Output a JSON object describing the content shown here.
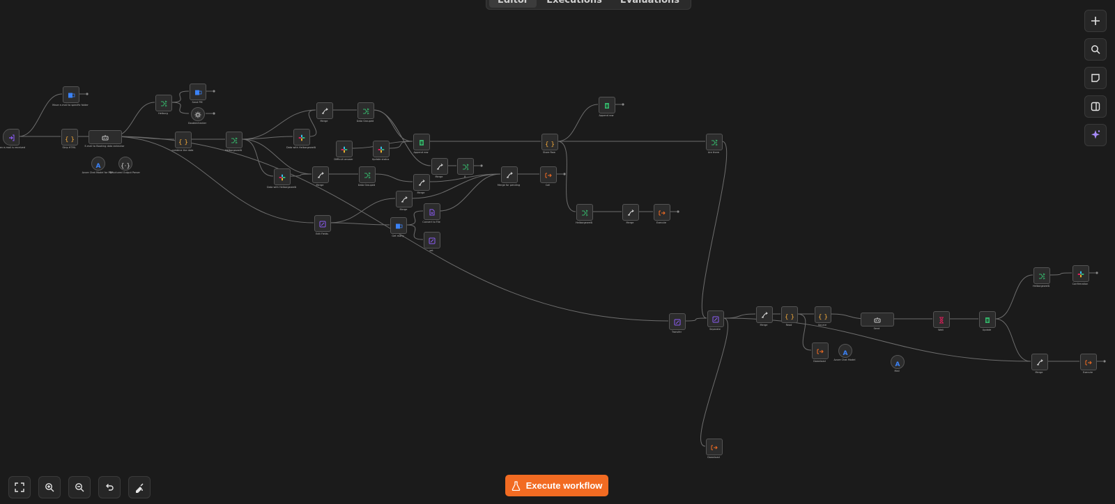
{
  "tabs": [
    {
      "label": "Editor",
      "active": true
    },
    {
      "label": "Executions",
      "active": false
    },
    {
      "label": "Evaluations",
      "active": false
    }
  ],
  "right_tools": [
    {
      "name": "add-node-icon",
      "glyph": "+"
    },
    {
      "name": "search-icon",
      "glyph": "⌕"
    },
    {
      "name": "sticky-note-icon",
      "glyph": "▢"
    },
    {
      "name": "panel-toggle-icon",
      "glyph": "◫"
    },
    {
      "name": "ai-sparkle-icon",
      "glyph": "✦"
    }
  ],
  "bottom_tools": [
    {
      "name": "fit-view-icon",
      "glyph": "⛶"
    },
    {
      "name": "zoom-in-icon",
      "glyph": "⊕"
    },
    {
      "name": "zoom-out-icon",
      "glyph": "⊖"
    },
    {
      "name": "undo-icon",
      "glyph": "↶"
    },
    {
      "name": "tidy-up-icon",
      "glyph": "✎"
    }
  ],
  "execute_button": {
    "label": "Execute workflow",
    "icon": "flask-icon"
  },
  "colors": {
    "background": "#1b1b1b",
    "accent": "#f26b22",
    "node_border": "#555555",
    "edge": "#6e6e6e",
    "green": "#35b46a",
    "blue": "#3b82f6",
    "purple": "#8b5cf6",
    "orange": "#f26b22"
  },
  "nodes": [
    {
      "id": "n1",
      "title": "When e-mail is received",
      "sub": "",
      "icon": "trigger",
      "color": "#8b5cf6"
    },
    {
      "id": "n2",
      "title": "Move e-mail to specific folder",
      "sub": "",
      "icon": "mail",
      "color": "#3b82f6"
    },
    {
      "id": "n3",
      "title": "Strip HTML",
      "sub": "",
      "icon": "code",
      "color": "#f2a93b"
    },
    {
      "id": "n4",
      "title": "E-mail to Booking data extractor",
      "sub": "",
      "icon": "agent",
      "color": "#cccccc"
    },
    {
      "id": "n5",
      "title": "Azure Chat Model for PDF",
      "sub": "",
      "icon": "model",
      "color": "#3b82f6"
    },
    {
      "id": "n6",
      "title": "Structured Output Parser",
      "sub": "",
      "icon": "parser",
      "color": "#cccccc"
    },
    {
      "id": "n7",
      "title": "Helburg",
      "sub": "",
      "icon": "switch",
      "color": "#35b46a"
    },
    {
      "id": "n8",
      "title": "Send PM",
      "sub": "",
      "icon": "mail",
      "color": "#3b82f6"
    },
    {
      "id": "n9",
      "title": "Doublechecker",
      "sub": "",
      "icon": "gear",
      "color": "#cccccc"
    },
    {
      "id": "n10",
      "title": "combine the data",
      "sub": "",
      "icon": "code",
      "color": "#f2a93b"
    },
    {
      "id": "n11",
      "title": "Helbargeweiß",
      "sub": "",
      "icon": "switch",
      "color": "#35b46a"
    },
    {
      "id": "n12",
      "title": "Data with Helbargeweiß",
      "sub": "",
      "icon": "slack",
      "color": "#e01e5a"
    },
    {
      "id": "n13",
      "title": "Data with Helbargeweiß",
      "sub": "",
      "icon": "slack",
      "color": "#e01e5a"
    },
    {
      "id": "n14",
      "title": "Merge",
      "sub": "",
      "icon": "merge",
      "color": "#35b46a"
    },
    {
      "id": "n15",
      "title": "Merge",
      "sub": "",
      "icon": "merge",
      "color": "#35b46a"
    },
    {
      "id": "n16",
      "title": "Data Grouped",
      "sub": "",
      "icon": "switch",
      "color": "#35b46a"
    },
    {
      "id": "n17",
      "title": "Data Grouped",
      "sub": "",
      "icon": "switch",
      "color": "#35b46a"
    },
    {
      "id": "n18",
      "title": "Difficult answer",
      "sub": "",
      "icon": "slack",
      "color": "#e01e5a"
    },
    {
      "id": "n19",
      "title": "Update status",
      "sub": "",
      "icon": "slack",
      "color": "#e01e5a"
    },
    {
      "id": "n20",
      "title": "Append row",
      "sub": "",
      "icon": "sheets",
      "color": "#35b46a"
    },
    {
      "id": "n21",
      "title": "Merge",
      "sub": "",
      "icon": "merge",
      "color": "#35b46a"
    },
    {
      "id": "n22",
      "title": "If",
      "sub": "",
      "icon": "switch",
      "color": "#35b46a"
    },
    {
      "id": "n23",
      "title": "Merge",
      "sub": "",
      "icon": "merge",
      "color": "#35b46a"
    },
    {
      "id": "n24",
      "title": "Merge",
      "sub": "",
      "icon": "merge",
      "color": "#35b46a"
    },
    {
      "id": "n25",
      "title": "Edit Fields",
      "sub": "",
      "icon": "edit",
      "color": "#8b5cf6"
    },
    {
      "id": "n26",
      "title": "Get many",
      "sub": "",
      "icon": "mail",
      "color": "#3b82f6"
    },
    {
      "id": "n27",
      "title": "Convert to File",
      "sub": "",
      "icon": "file",
      "color": "#8b5cf6"
    },
    {
      "id": "n28",
      "title": "set",
      "sub": "",
      "icon": "edit",
      "color": "#8b5cf6"
    },
    {
      "id": "n29",
      "title": "Merge for pending",
      "sub": "",
      "icon": "merge",
      "color": "#35b46a"
    },
    {
      "id": "n30",
      "title": "Call",
      "sub": "",
      "icon": "exec",
      "color": "#f26b22"
    },
    {
      "id": "n31",
      "title": "Store Row",
      "sub": "",
      "icon": "code",
      "color": "#f2a93b"
    },
    {
      "id": "n32",
      "title": "Append row",
      "sub": "",
      "icon": "sheets",
      "color": "#35b46a"
    },
    {
      "id": "n33",
      "title": "Helbargeweiß",
      "sub": "",
      "icon": "switch",
      "color": "#35b46a"
    },
    {
      "id": "n34",
      "title": "Merge",
      "sub": "",
      "icon": "merge",
      "color": "#35b46a"
    },
    {
      "id": "n35",
      "title": "Execute",
      "sub": "",
      "icon": "exec",
      "color": "#f26b22"
    },
    {
      "id": "n36",
      "title": "Are there",
      "sub": "",
      "icon": "switch",
      "color": "#35b46a"
    },
    {
      "id": "n37",
      "title": "Transfer",
      "sub": "",
      "icon": "edit",
      "color": "#8b5cf6"
    },
    {
      "id": "n38",
      "title": "Separate",
      "sub": "",
      "icon": "edit",
      "color": "#8b5cf6"
    },
    {
      "id": "n39",
      "title": "Merge",
      "sub": "",
      "icon": "merge",
      "color": "#35b46a"
    },
    {
      "id": "n40",
      "title": "Read",
      "sub": "",
      "icon": "code",
      "color": "#f2a93b"
    },
    {
      "id": "n41",
      "title": "Source",
      "sub": "",
      "icon": "code",
      "color": "#f2a93b"
    },
    {
      "id": "n42",
      "title": "Send",
      "sub": "",
      "icon": "agent",
      "color": "#cccccc"
    },
    {
      "id": "n43",
      "title": "Download",
      "sub": "",
      "icon": "exec",
      "color": "#f26b22"
    },
    {
      "id": "n44",
      "title": "Azure Chat Model",
      "sub": "",
      "icon": "model",
      "color": "#3b82f6"
    },
    {
      "id": "n45",
      "title": "Mail",
      "sub": "",
      "icon": "model",
      "color": "#3b82f6"
    },
    {
      "id": "n46",
      "title": "Wait",
      "sub": "",
      "icon": "wait",
      "color": "#e01e5a"
    },
    {
      "id": "n47",
      "title": "Update",
      "sub": "",
      "icon": "sheets",
      "color": "#35b46a"
    },
    {
      "id": "n48",
      "title": "Helbargeweiß",
      "sub": "",
      "icon": "switch",
      "color": "#35b46a"
    },
    {
      "id": "n49",
      "title": "Confirmation",
      "sub": "",
      "icon": "slack",
      "color": "#e01e5a"
    },
    {
      "id": "n50",
      "title": "Merge",
      "sub": "",
      "icon": "merge",
      "color": "#35b46a"
    },
    {
      "id": "n51",
      "title": "Execute",
      "sub": "",
      "icon": "exec",
      "color": "#f26b22"
    },
    {
      "id": "n52",
      "title": "Download",
      "sub": "",
      "icon": "exec",
      "color": "#f26b22"
    }
  ]
}
